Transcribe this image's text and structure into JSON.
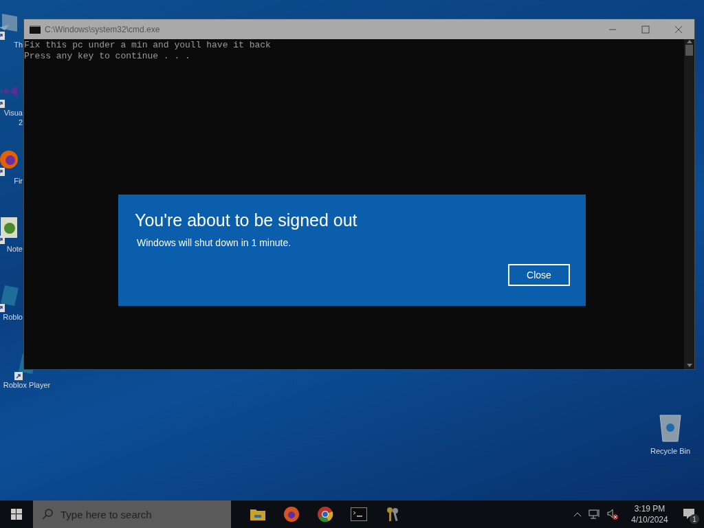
{
  "desktop_icons": [
    {
      "kind": "generic",
      "label_lines": [
        "Th"
      ]
    },
    {
      "kind": "visualstudio",
      "label_lines": [
        "Visua",
        "2"
      ]
    },
    {
      "kind": "firefox",
      "label_lines": [
        "Fir"
      ]
    },
    {
      "kind": "notepad",
      "label_lines": [
        "Note"
      ]
    },
    {
      "kind": "roblox",
      "label_lines": [
        "Roblo"
      ]
    },
    {
      "kind": "roblox",
      "label_lines": [
        "Roblox Player"
      ]
    }
  ],
  "recycle_bin": {
    "label": "Recycle Bin"
  },
  "console_window": {
    "title": "C:\\Windows\\system32\\cmd.exe",
    "lines": [
      "Fix this pc under a min and youll have it back",
      "Press any key to continue . . ."
    ]
  },
  "dialog": {
    "title": "You're about to be signed out",
    "message": "Windows will shut down in 1 minute.",
    "button": "Close"
  },
  "taskbar": {
    "search_placeholder": "Type here to search",
    "apps": [
      {
        "kind": "explorer"
      },
      {
        "kind": "firefox"
      },
      {
        "kind": "chrome"
      },
      {
        "kind": "terminal"
      },
      {
        "kind": "keys"
      }
    ],
    "time": "3:19 PM",
    "date": "4/10/2024",
    "notification_count": "1"
  }
}
